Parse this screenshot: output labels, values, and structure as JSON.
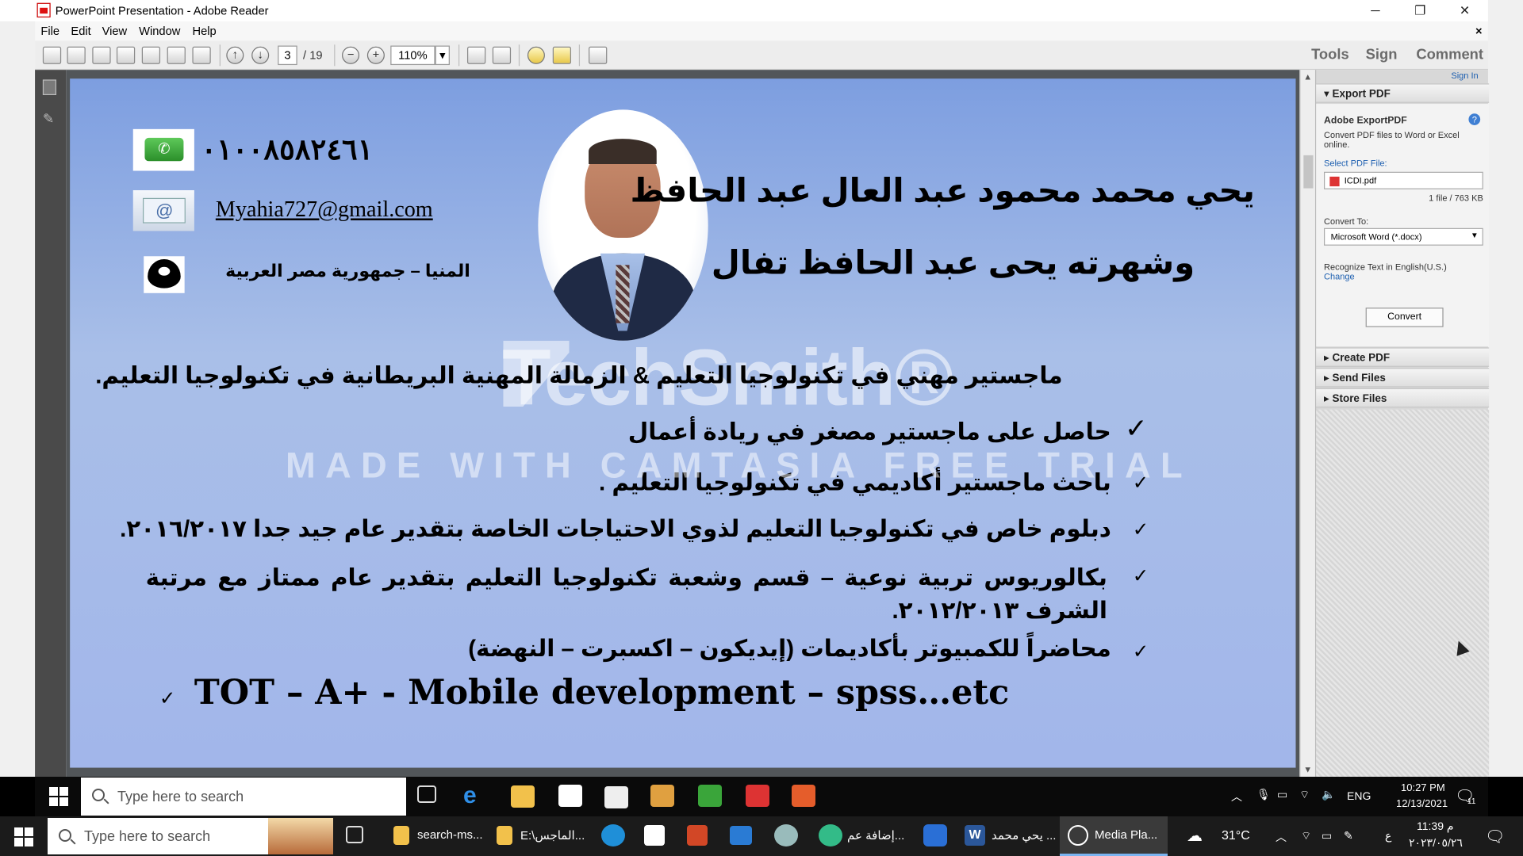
{
  "window": {
    "title": "PowerPoint Presentation - Adobe Reader",
    "controls": {
      "minimize": "─",
      "restore": "❐",
      "close": "✕"
    }
  },
  "menu": [
    "File",
    "Edit",
    "View",
    "Window",
    "Help"
  ],
  "toolbar": {
    "page_current": "3",
    "page_total": "/ 19",
    "zoom": "110%",
    "right_tabs": [
      "Tools",
      "Sign",
      "Comment"
    ]
  },
  "slide": {
    "phone": "٠١٠٠٨٥٨٢٤٦١",
    "email": "Myahia727@gmail.com",
    "location": "المنيا – جمهورية مصر العربية",
    "name_line1": "يحي محمد محمود عبد العال عبد الحافظ",
    "name_line2": "وشهرته يحى عبد الحافظ تفال",
    "masters": "ماجستير مهني في تكنولوجيا التعليم  &  الزمالة المهنية البريطانية في تكنولوجيا التعليم.",
    "bullets": [
      "حاصل على ماجستير مصغر في ريادة أعمال",
      "باحث ماجستير أكاديمي في تكنولوجيا التعليم .",
      "دبلوم خاص في تكنولوجيا التعليم لذوي الاحتياجات الخاصة بتقدير عام  جيد جدا ٢٠١٦/٢٠١٧.",
      "بكالوريوس تربية نوعية – قسم وشعبة تكنولوجيا التعليم بتقدير عام ممتاز مع مرتبة الشرف ٢٠١٢/٢٠١٣.",
      "محاضراً للكمبيوتر بأكاديمات (إيديكون    – اكسبرت – النهضة)"
    ],
    "tot_line": "TOT – A+ - Mobile development – spss…etc",
    "check": "✓",
    "watermark_brand": "TechSmith®",
    "watermark_trial": "MADE WITH CAMTASIA FREE TRIAL"
  },
  "right_panel": {
    "sign_in": "Sign In",
    "export_pdf": "Export PDF",
    "adobe_export": "Adobe ExportPDF",
    "description": "Convert PDF files to Word or Excel online.",
    "select_label": "Select PDF File:",
    "file_name": "ICDI.pdf",
    "file_info": "1 file / 763 KB",
    "convert_to": "Convert To:",
    "format": "Microsoft Word (*.docx)",
    "recognize": "Recognize Text in English(U.S.)",
    "change": "Change",
    "convert_button": "Convert",
    "sections": [
      "Create PDF",
      "Send Files",
      "Store Files"
    ]
  },
  "taskbar_recorded": {
    "search_placeholder": "Type here to search",
    "time": "10:27 PM",
    "date": "12/13/2021",
    "lang": "ENG",
    "notif_count": "11"
  },
  "taskbar_host": {
    "search_placeholder": "Type here to search",
    "apps": [
      "search-ms...",
      "E:\\الماجس...",
      "إضافة عم...",
      "يحي محمد ...",
      "Media Pla..."
    ],
    "weather": "31°C",
    "lang": "ع",
    "time": "11:39 م",
    "date": "٢٠٢٣/٠٥/٢٦"
  },
  "colors": {
    "slide_top": "#7d9ee0",
    "slide_bottom": "#a2b6ea",
    "accent_link": "#1d5fb0"
  }
}
